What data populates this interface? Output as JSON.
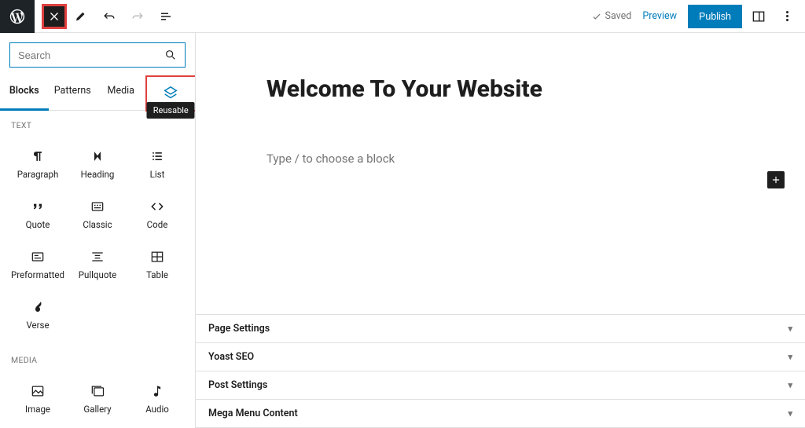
{
  "toolbar": {
    "saved_label": "Saved",
    "preview_label": "Preview",
    "publish_label": "Publish"
  },
  "sidebar": {
    "search_placeholder": "Search",
    "tabs": {
      "blocks": "Blocks",
      "patterns": "Patterns",
      "media": "Media",
      "reusable_tooltip": "Reusable"
    },
    "cat_text": "TEXT",
    "cat_media": "MEDIA",
    "text_blocks": [
      {
        "name": "Paragraph"
      },
      {
        "name": "Heading"
      },
      {
        "name": "List"
      },
      {
        "name": "Quote"
      },
      {
        "name": "Classic"
      },
      {
        "name": "Code"
      },
      {
        "name": "Preformatted"
      },
      {
        "name": "Pullquote"
      },
      {
        "name": "Table"
      },
      {
        "name": "Verse"
      }
    ],
    "media_blocks": [
      {
        "name": "Image"
      },
      {
        "name": "Gallery"
      },
      {
        "name": "Audio"
      }
    ]
  },
  "editor": {
    "title": "Welcome To Your Website",
    "placeholder": "Type / to choose a block"
  },
  "panels": [
    "Page Settings",
    "Yoast SEO",
    "Post Settings",
    "Mega Menu Content"
  ]
}
